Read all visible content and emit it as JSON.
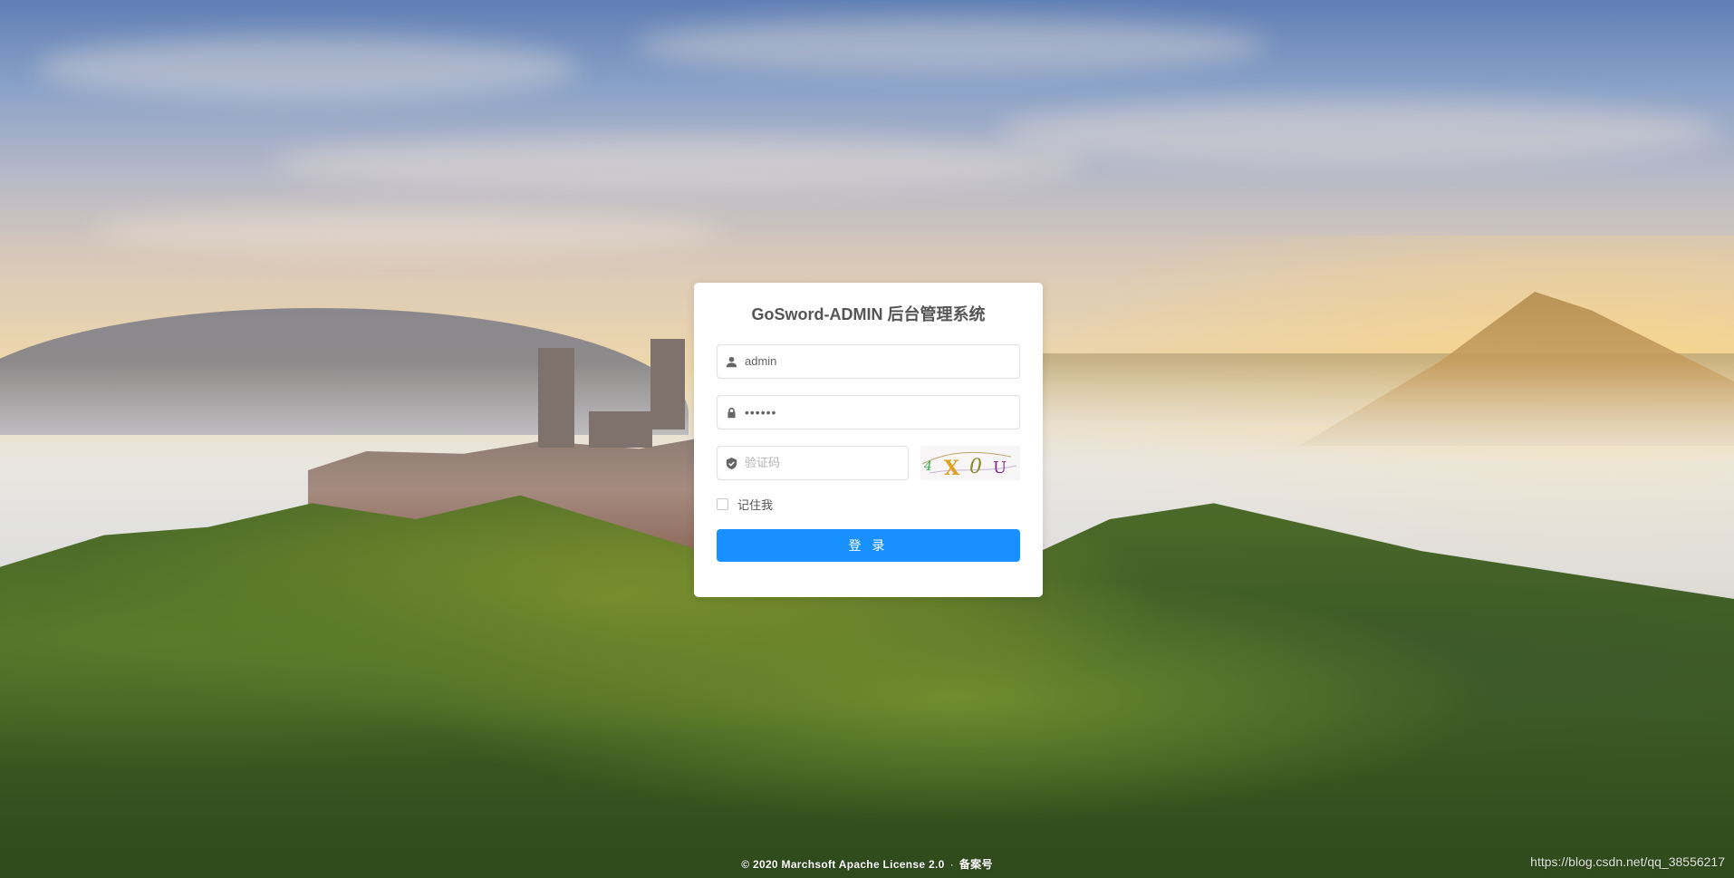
{
  "login": {
    "title": "GoSword-ADMIN 后台管理系统",
    "username": {
      "value": "admin",
      "icon": "user-icon"
    },
    "password": {
      "value": "••••••",
      "icon": "lock-icon"
    },
    "captcha": {
      "placeholder": "验证码",
      "icon": "shield-check-icon",
      "image_text": "4X0U"
    },
    "remember_label": "记住我",
    "remember_checked": false,
    "submit_label": "登 录"
  },
  "footer": {
    "copyright": "© 2020 Marchsoft Apache License 2.0",
    "separator": "·",
    "icp": "备案号"
  },
  "watermark": "https://blog.csdn.net/qq_38556217",
  "colors": {
    "primary": "#1890ff",
    "title": "#555555",
    "border": "#dcdfe6"
  }
}
